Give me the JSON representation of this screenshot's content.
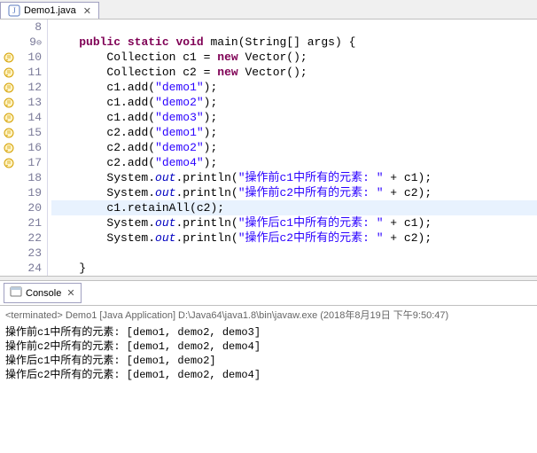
{
  "tab": {
    "filename": "Demo1.java"
  },
  "editor": {
    "lines": [
      {
        "num": 8,
        "icon": "",
        "fold": "",
        "hl": false
      },
      {
        "num": 9,
        "icon": "",
        "fold": "⊖",
        "hl": false
      },
      {
        "num": 10,
        "icon": "warn",
        "fold": "",
        "hl": false
      },
      {
        "num": 11,
        "icon": "warn",
        "fold": "",
        "hl": false
      },
      {
        "num": 12,
        "icon": "warn",
        "fold": "",
        "hl": false
      },
      {
        "num": 13,
        "icon": "warn",
        "fold": "",
        "hl": false
      },
      {
        "num": 14,
        "icon": "warn",
        "fold": "",
        "hl": false
      },
      {
        "num": 15,
        "icon": "warn",
        "fold": "",
        "hl": false
      },
      {
        "num": 16,
        "icon": "warn",
        "fold": "",
        "hl": false
      },
      {
        "num": 17,
        "icon": "warn",
        "fold": "",
        "hl": false
      },
      {
        "num": 18,
        "icon": "",
        "fold": "",
        "hl": false
      },
      {
        "num": 19,
        "icon": "",
        "fold": "",
        "hl": false
      },
      {
        "num": 20,
        "icon": "",
        "fold": "",
        "hl": true
      },
      {
        "num": 21,
        "icon": "",
        "fold": "",
        "hl": false
      },
      {
        "num": 22,
        "icon": "",
        "fold": "",
        "hl": false
      },
      {
        "num": 23,
        "icon": "",
        "fold": "",
        "hl": false
      },
      {
        "num": 24,
        "icon": "",
        "fold": "",
        "hl": false
      }
    ],
    "tokens": {
      "kw_public": "public",
      "kw_static": "static",
      "kw_void": "void",
      "kw_new": "new",
      "id_main": "main",
      "ty_String": "String",
      "id_args": "args",
      "ty_Collection": "Collection",
      "ty_Vector": "Vector",
      "id_c1": "c1",
      "id_c2": "c2",
      "m_add": "add",
      "m_retainAll": "retainAll",
      "m_println": "println",
      "id_System": "System",
      "f_out": "out",
      "s_demo1": "\"demo1\"",
      "s_demo2": "\"demo2\"",
      "s_demo3": "\"demo3\"",
      "s_demo4": "\"demo4\"",
      "s_pre_c1": "\"操作前c1中所有的元素: \"",
      "s_pre_c2": "\"操作前c2中所有的元素: \"",
      "s_post_c1": "\"操作后c1中所有的元素: \"",
      "s_post_c2": "\"操作后c2中所有的元素: \""
    }
  },
  "console": {
    "title": "Console",
    "terminated": "<terminated> Demo1 [Java Application] D:\\Java64\\java1.8\\bin\\javaw.exe (2018年8月19日 下午9:50:47)",
    "output": [
      "操作前c1中所有的元素: [demo1, demo2, demo3]",
      "操作前c2中所有的元素: [demo1, demo2, demo4]",
      "操作后c1中所有的元素: [demo1, demo2]",
      "操作后c2中所有的元素: [demo1, demo2, demo4]"
    ]
  }
}
